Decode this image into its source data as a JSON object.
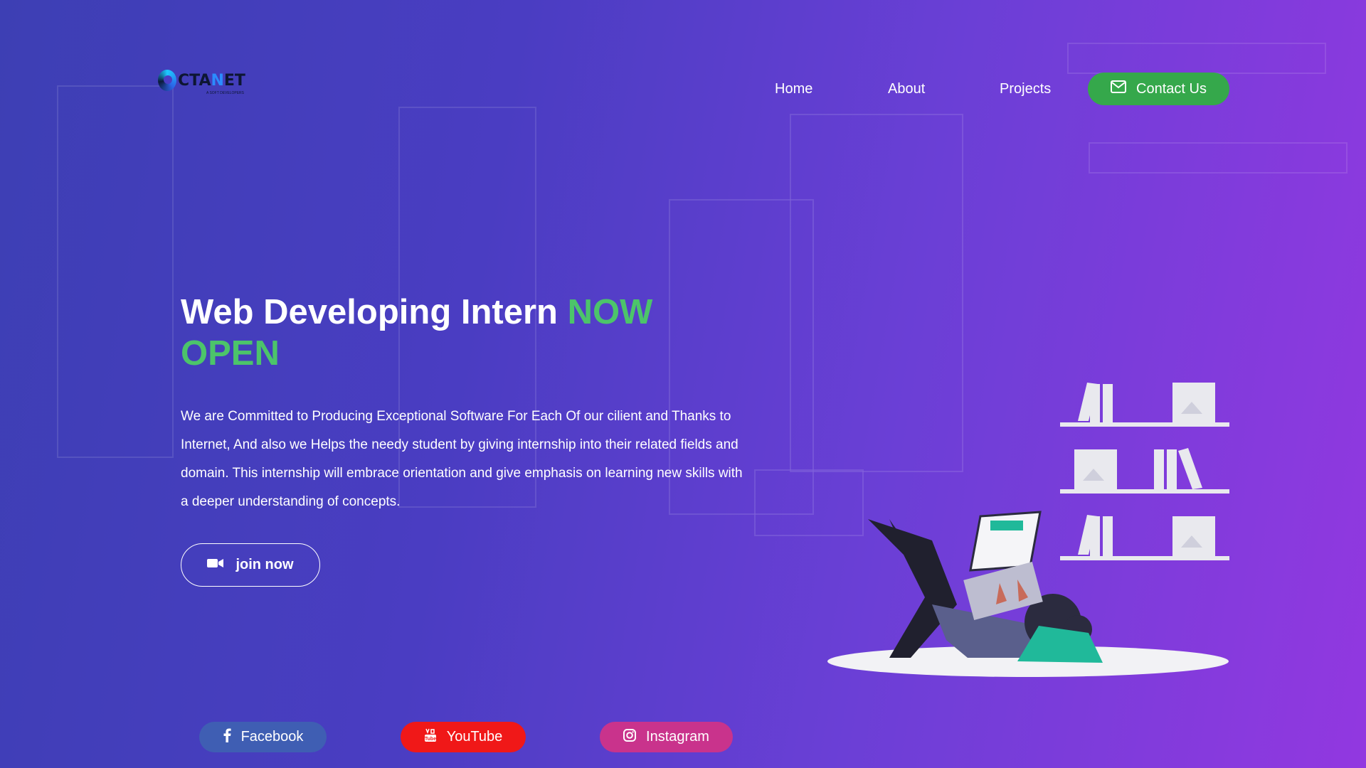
{
  "brand": {
    "logo_text_prefix": "CTA",
    "logo_text_accent": "N",
    "logo_text_suffix": "ET",
    "logo_subtitle": "A SOFT DEVELOPERS"
  },
  "nav": {
    "items": [
      {
        "label": "Home"
      },
      {
        "label": "About"
      },
      {
        "label": "Projects"
      }
    ],
    "contact_label": "Contact Us"
  },
  "hero": {
    "title_main": "Web Developing Intern ",
    "title_accent": "NOW OPEN",
    "description": "We are Committed to Producing Exceptional Software For Each Of our cilient and Thanks to Internet, And also we Helps the needy student by giving internship into their related fields and domain. This internship will embrace orientation and give emphasis on learning new skills with a deeper understanding of concepts.",
    "cta_label": "join now"
  },
  "socials": [
    {
      "label": "Facebook",
      "icon": "facebook-icon",
      "color": "#3f5eb3"
    },
    {
      "label": "YouTube",
      "icon": "youtube-icon",
      "color": "#f01818"
    },
    {
      "label": "Instagram",
      "icon": "instagram-icon",
      "color": "#c9338c"
    }
  ],
  "colors": {
    "accent_green": "#4cc46a",
    "contact_button": "#35a84b"
  }
}
